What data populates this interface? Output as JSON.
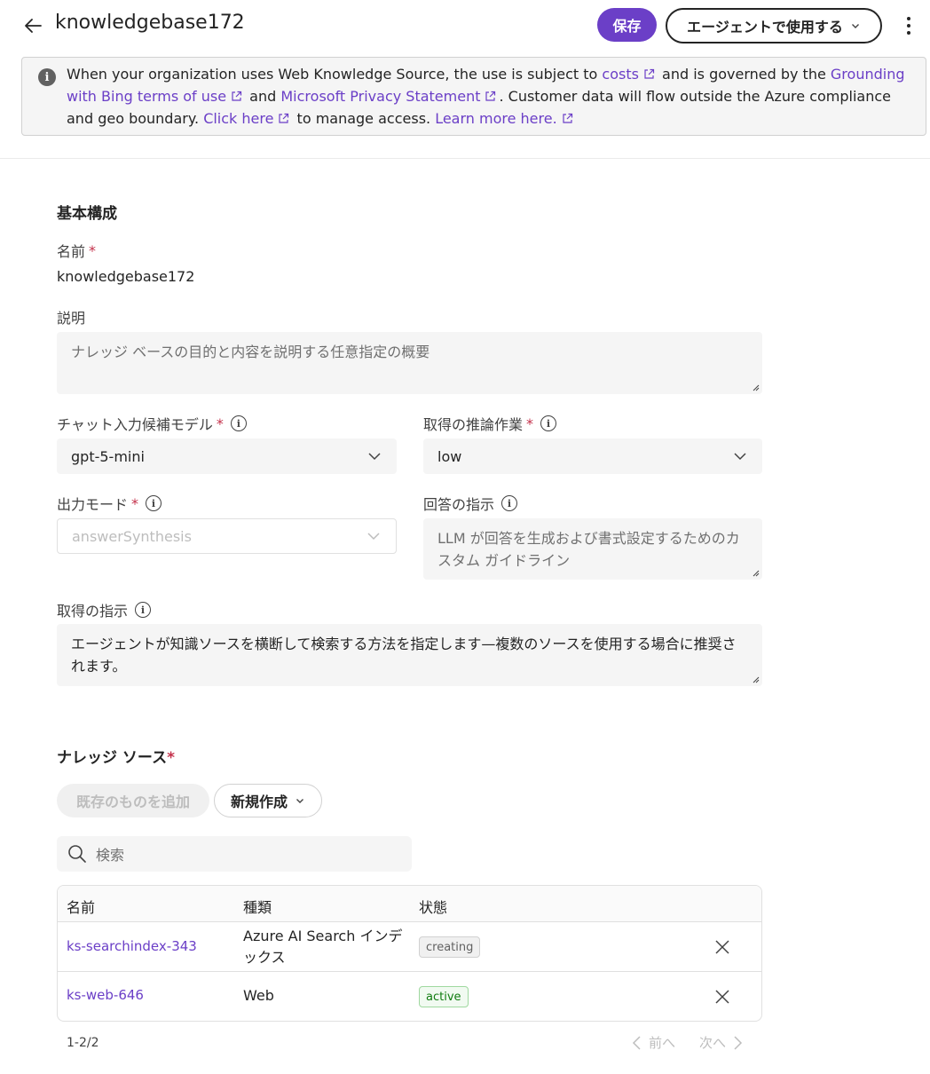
{
  "header": {
    "title": "knowledgebase172",
    "save_label": "保存",
    "use_in_agent_label": "エージェントで使用する"
  },
  "banner": {
    "t1": "When your organization uses Web Knowledge Source, the use is subject to ",
    "link_costs": "costs",
    "t2": " and is governed by the ",
    "link_grounding": "Grounding with Bing terms of use",
    "t3": " and ",
    "link_privacy": "Microsoft Privacy Statement",
    "t4": ". Customer data will flow outside the Azure compliance and geo boundary. ",
    "link_click_here": "Click here",
    "t5": " to manage access. ",
    "link_learn_more": "Learn more here."
  },
  "form": {
    "section_title": "基本構成",
    "required_mark": "*",
    "name_label": "名前",
    "name_value": "knowledgebase172",
    "description_label": "説明",
    "description_placeholder": "ナレッジ ベースの目的と内容を説明する任意指定の概要",
    "chat_model_label": "チャット入力候補モデル",
    "chat_model_value": "gpt-5-mini",
    "reasoning_label": "取得の推論作業",
    "reasoning_value": "low",
    "output_mode_label": "出力モード",
    "output_mode_value": "answerSynthesis",
    "answer_instructions_label": "回答の指示",
    "answer_instructions_placeholder": "LLM が回答を生成および書式設定するためのカスタム ガイドライン",
    "retrieval_instructions_label": "取得の指示",
    "retrieval_instructions_value": "エージェントが知識ソースを横断して検索する方法を指定します—複数のソースを使用する場合に推奨されます。"
  },
  "knowledge_sources": {
    "title": "ナレッジ ソース",
    "add_existing_label": "既存のものを追加",
    "create_new_label": "新規作成",
    "search_placeholder": "検索",
    "columns": [
      "名前",
      "種類",
      "状態"
    ],
    "rows": [
      {
        "name": "ks-searchindex-343",
        "type": "Azure AI Search インデックス",
        "status": "creating"
      },
      {
        "name": "ks-web-646",
        "type": "Web",
        "status": "active"
      }
    ],
    "page_count": "1-2/2",
    "prev_label": "前へ",
    "next_label": "次へ"
  },
  "colors": {
    "accent": "#6b3fc7",
    "required": "#c4314b",
    "active_green": "#107c10"
  },
  "icons": [
    "back-arrow-icon",
    "more-vertical-icon",
    "info-icon",
    "external-link-icon",
    "chevron-down-icon",
    "search-icon",
    "close-icon",
    "chevron-left-icon",
    "chevron-right-icon"
  ]
}
